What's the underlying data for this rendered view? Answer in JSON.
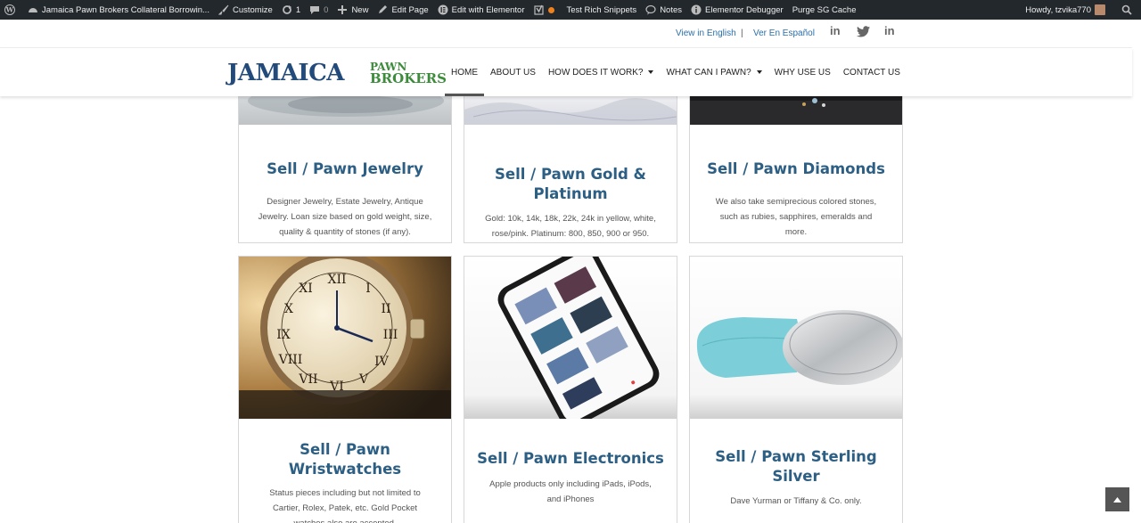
{
  "admin_bar": {
    "site_title": "Jamaica Pawn Brokers Collateral Borrowin...",
    "customize": "Customize",
    "updates_count": "1",
    "comments_count": "0",
    "new_label": "New",
    "edit_page": "Edit Page",
    "edit_elementor": "Edit with Elementor",
    "test_snippets": "Test Rich Snippets",
    "notes": "Notes",
    "elementor_debugger": "Elementor Debugger",
    "purge_cache": "Purge SG Cache",
    "howdy": "Howdy, tzvika770"
  },
  "header": {
    "lang_english": "View in English",
    "lang_separator": "|",
    "lang_spanish": "Ver En Español",
    "social_icons": [
      "linkedin-icon",
      "twitter-icon",
      "linkedin-icon"
    ],
    "logo_main": "JAMAICA",
    "logo_sub_1": "PAWN",
    "logo_sub_2": "BROKERS"
  },
  "nav": {
    "items": [
      {
        "label": "HOME",
        "active": true
      },
      {
        "label": "ABOUT US"
      },
      {
        "label": "HOW DOES IT WORK?",
        "dropdown": true
      },
      {
        "label": "WHAT CAN I PAWN?",
        "dropdown": true
      },
      {
        "label": "WHY USE US"
      },
      {
        "label": "CONTACT US"
      }
    ]
  },
  "cards": {
    "jewelry": {
      "title": "Sell / Pawn Jewelry",
      "desc_1": "Designer Jewelry, Estate Jewelry, Antique",
      "desc_2": "Jewelry. Loan size based on gold weight, size,",
      "desc_3": "quality & quantity of stones (if any)."
    },
    "gold": {
      "title_1": "Sell / Pawn Gold &",
      "title_2": "Platinum",
      "desc_1": "Gold: 10k, 14k, 18k, 22k, 24k in yellow, white,",
      "desc_2": "rose/pink. Platinum: 800, 850, 900 or 950."
    },
    "diamonds": {
      "title": "Sell / Pawn Diamonds",
      "desc_1": "We also take semiprecious colored stones,",
      "desc_2": "such as rubies, sapphires, emeralds and",
      "desc_3": "more."
    },
    "watches": {
      "title_1": "Sell / Pawn",
      "title_2": "Wristwatches",
      "desc_1": "Status pieces including but not limited to",
      "desc_2": "Cartier, Rolex, Patek, etc. Gold Pocket",
      "desc_3": "watches also are accepted."
    },
    "electronics": {
      "title": "Sell / Pawn Electronics",
      "desc_1": "Apple products only including iPads, iPods,",
      "desc_2": "and iPhones"
    },
    "silver": {
      "title_1": "Sell / Pawn Sterling",
      "title_2": "Silver",
      "desc_1": "Dave Yurman or Tiffany & Co. only."
    }
  },
  "colors": {
    "admin_bar_bg": "#23282d",
    "title_blue": "#2c5f83",
    "logo_blue": "#224a7a",
    "logo_green": "#3c8c3c",
    "link_blue": "#2c6fa8"
  }
}
